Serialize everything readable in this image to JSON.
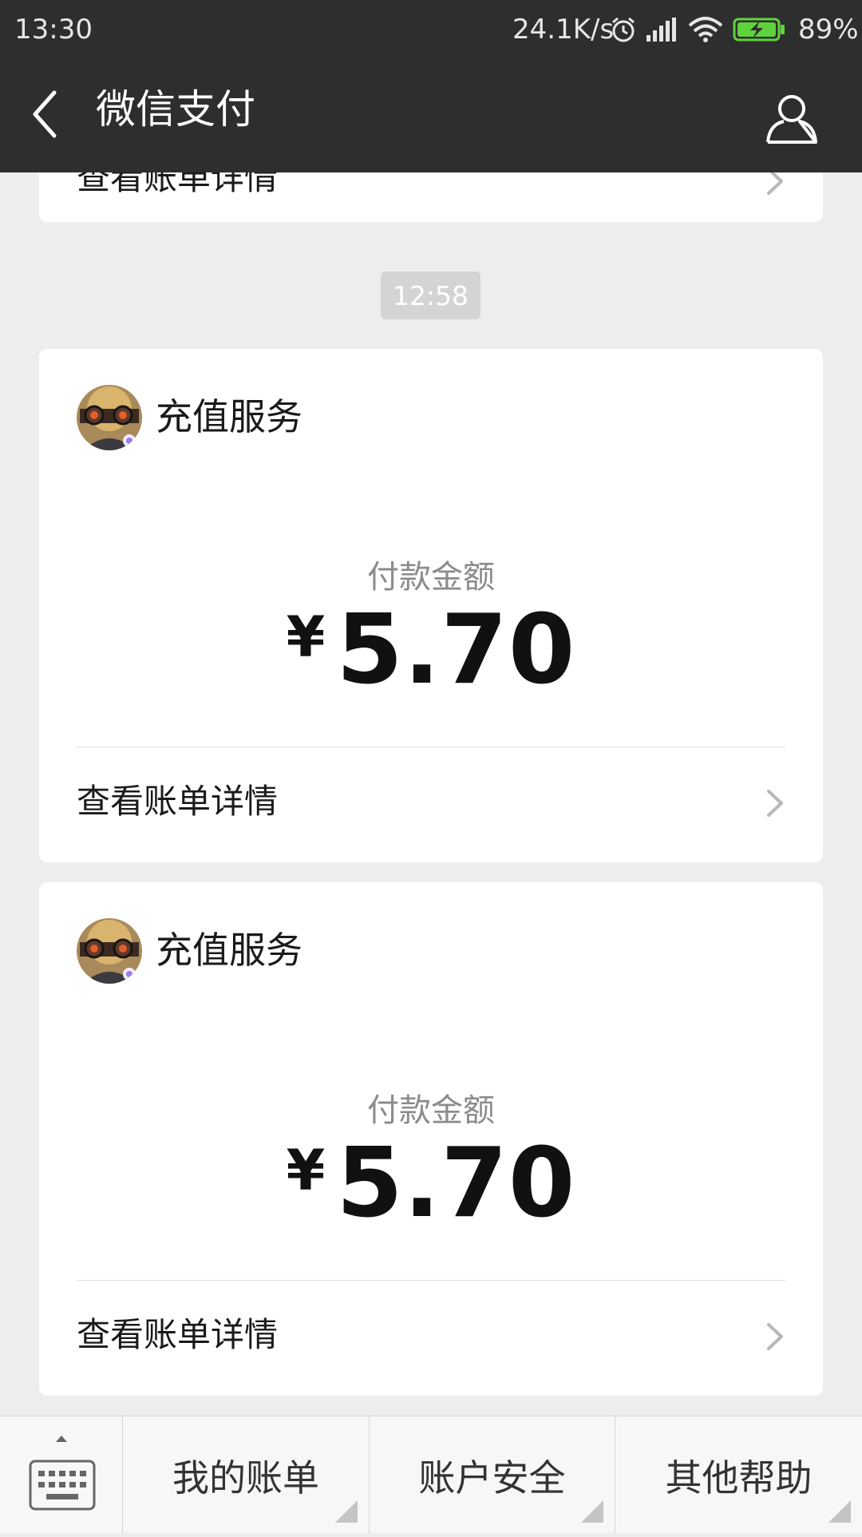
{
  "status_bar": {
    "time": "13:30",
    "network_rate": "24.1K/s",
    "battery_percent": "89%",
    "icons": [
      "alarm-icon",
      "signal-icon",
      "wifi-icon",
      "battery-charging-icon"
    ]
  },
  "header": {
    "title": "微信支付",
    "back_icon": "back-arrow-icon",
    "profile_icon": "person-icon"
  },
  "top_card": {
    "link_label": "查看账单详情"
  },
  "time_divider": "12:58",
  "payments": [
    {
      "merchant": "充值服务",
      "amount_label": "付款金额",
      "currency": "¥",
      "amount": "5.70",
      "link_label": "查看账单详情"
    },
    {
      "merchant": "充值服务",
      "amount_label": "付款金额",
      "currency": "¥",
      "amount": "5.70",
      "link_label": "查看账单详情"
    }
  ],
  "bottom_menu": {
    "keyboard_icon": "keyboard-icon",
    "items": [
      {
        "label": "我的账单"
      },
      {
        "label": "账户安全"
      },
      {
        "label": "其他帮助"
      }
    ]
  },
  "colors": {
    "header_bg": "#2e2e2e",
    "page_bg": "#ededed",
    "card_bg": "#ffffff",
    "battery_green": "#5fd33c"
  }
}
